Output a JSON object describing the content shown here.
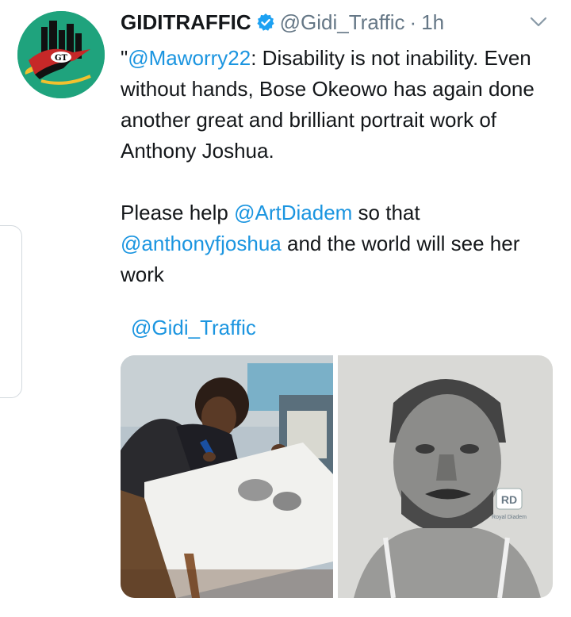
{
  "author": {
    "name": "GIDITRAFFIC",
    "handle": "@Gidi_Traffic",
    "separator": "·",
    "time": "1h",
    "verified": true,
    "avatar_initials": "GT",
    "avatar_color": "#1fa37d"
  },
  "tweet": {
    "line1_prefix": "\"",
    "line1_mention": "@Maworry22",
    "line1_text": ": Disability is not inability. Even without hands,  Bose Okeowo has again done another great and brilliant portrait work of Anthony Joshua.",
    "line2_prefix": "Please help ",
    "line2_mention1": "@ArtDiadem",
    "line2_middle": " so that ",
    "line2_mention2": "@anthonyfjoshua",
    "line2_suffix": " and the world will see her work"
  },
  "quote_handle": "@Gidi_Traffic",
  "media": {
    "left_photo": "girl-drawing-photo",
    "right_photo": "pencil-portrait-photo",
    "watermark_logo": "RD",
    "watermark_text": "Royal Diadem"
  },
  "icons": {
    "verified": "verified-badge-icon",
    "caret": "chevron-down-icon"
  },
  "colors": {
    "link": "#1b95e0",
    "secondary": "#657786",
    "verified": "#1da1f2"
  }
}
